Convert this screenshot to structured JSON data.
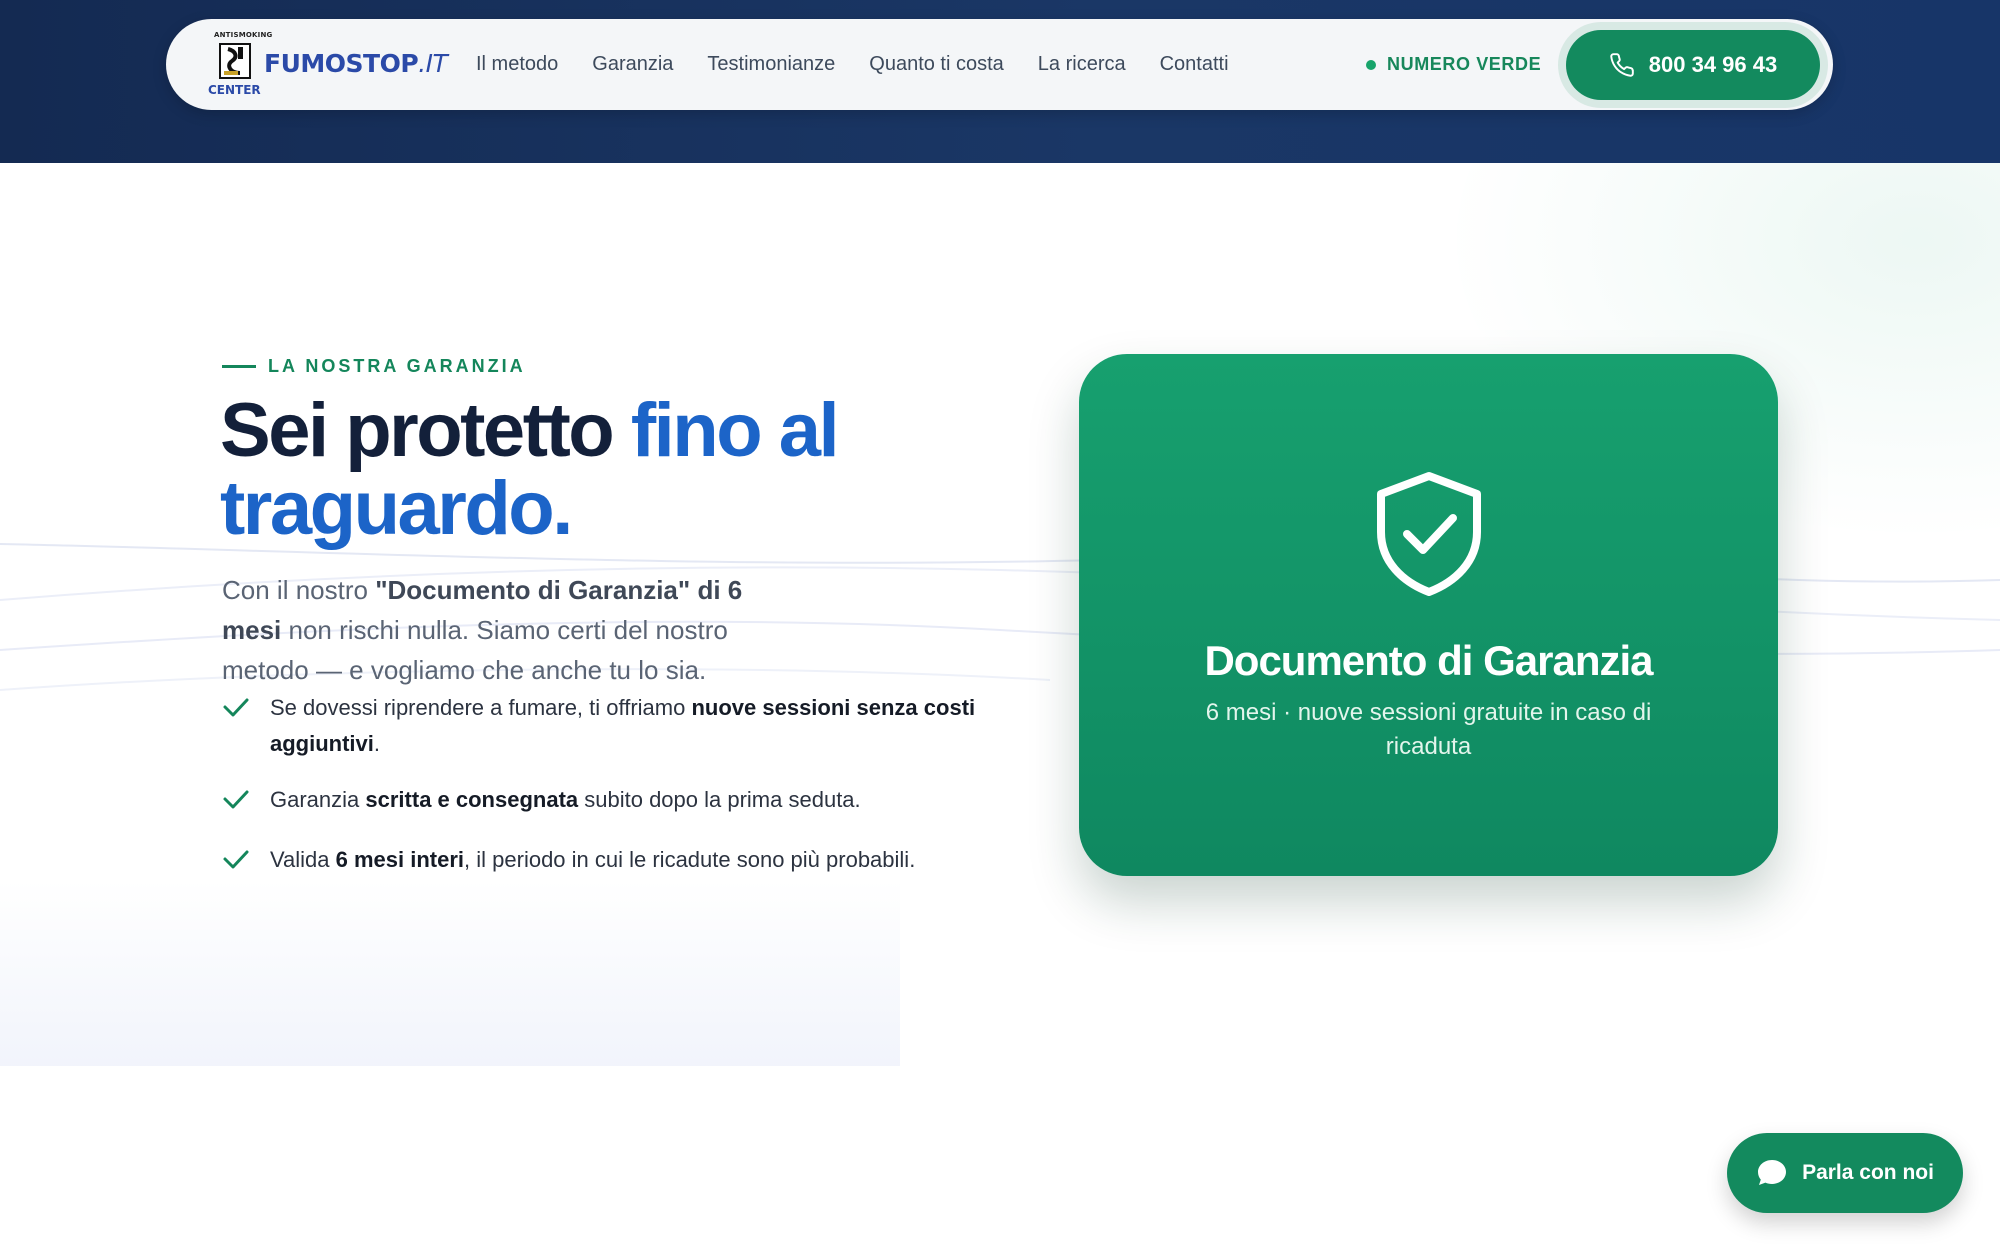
{
  "brand": {
    "top_text": "ANTISMOKING",
    "name": "FUMOSTOP",
    "tld": ".IT",
    "sub": "CENTER"
  },
  "nav": {
    "links": [
      {
        "label": "Il metodo"
      },
      {
        "label": "Garanzia"
      },
      {
        "label": "Testimonianze"
      },
      {
        "label": "Quanto ti costa"
      },
      {
        "label": "La ricerca"
      },
      {
        "label": "Contatti"
      }
    ],
    "numero_verde_label": "NUMERO VERDE",
    "phone_number": "800 34 96 43"
  },
  "hero": {
    "eyebrow": "LA NOSTRA GARANZIA",
    "headline_part1": "Sei protetto ",
    "headline_part2": "fino al traguardo.",
    "intro": {
      "pre": "Con il nostro ",
      "bold": "\"Documento di Garanzia\" di 6 mesi",
      "post": " non rischi nulla. Siamo certi del nostro metodo — e vogliamo che anche tu lo sia."
    },
    "checks": [
      {
        "pre": "Se dovessi riprendere a fumare, ti offriamo ",
        "bold": "nuove sessioni senza costi aggiuntivi",
        "post": "."
      },
      {
        "pre": "Garanzia ",
        "bold": "scritta e consegnata",
        "post": " subito dopo la prima seduta."
      },
      {
        "pre": "Valida ",
        "bold": "6 mesi interi",
        "post": ", il periodo in cui le ricadute sono più probabili."
      }
    ]
  },
  "card": {
    "icon": "shield-check-icon",
    "title": "Documento di Garanzia",
    "subtitle": "6 mesi · nuove sessioni gratuite in caso di ricaduta"
  },
  "chat": {
    "label": "Parla con noi",
    "icon": "chat-bubble-icon"
  },
  "colors": {
    "navy": "#142a52",
    "green": "#138a5e",
    "blue": "#1c64c8",
    "heading": "#13203a"
  }
}
